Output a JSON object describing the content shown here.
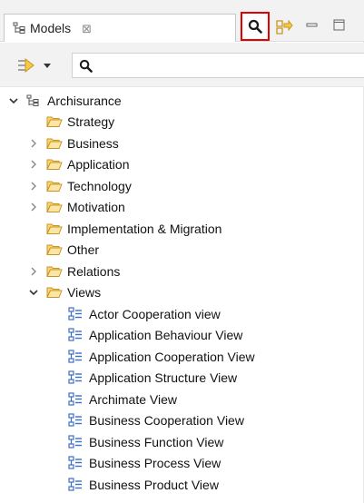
{
  "tab": {
    "label": "Models",
    "close_glyph": "⊠"
  },
  "toolbar": {
    "icons": [
      "search-icon",
      "link-with-editor-icon",
      "minimize-icon",
      "maximize-icon"
    ],
    "highlight_color": "#e20000"
  },
  "search": {
    "value": "",
    "placeholder": ""
  },
  "tree": {
    "root": {
      "label": "Archisurance",
      "expanded": true
    },
    "folders": [
      {
        "label": "Strategy",
        "expandable": false
      },
      {
        "label": "Business",
        "expandable": true
      },
      {
        "label": "Application",
        "expandable": true
      },
      {
        "label": "Technology",
        "expandable": true
      },
      {
        "label": "Motivation",
        "expandable": true
      },
      {
        "label": "Implementation & Migration",
        "expandable": false
      },
      {
        "label": "Other",
        "expandable": false
      },
      {
        "label": "Relations",
        "expandable": true
      },
      {
        "label": "Views",
        "expandable": true,
        "expanded": true
      }
    ],
    "views": [
      "Actor Cooperation view",
      "Application Behaviour View",
      "Application Cooperation View",
      "Application Structure View",
      "Archimate View",
      "Business Cooperation View",
      "Business Function View",
      "Business Process View",
      "Business Product View"
    ]
  },
  "colors": {
    "folder_fill": "#f9d77a",
    "folder_stroke": "#c9951f",
    "view_icon_blue": "#3d6fc4"
  }
}
